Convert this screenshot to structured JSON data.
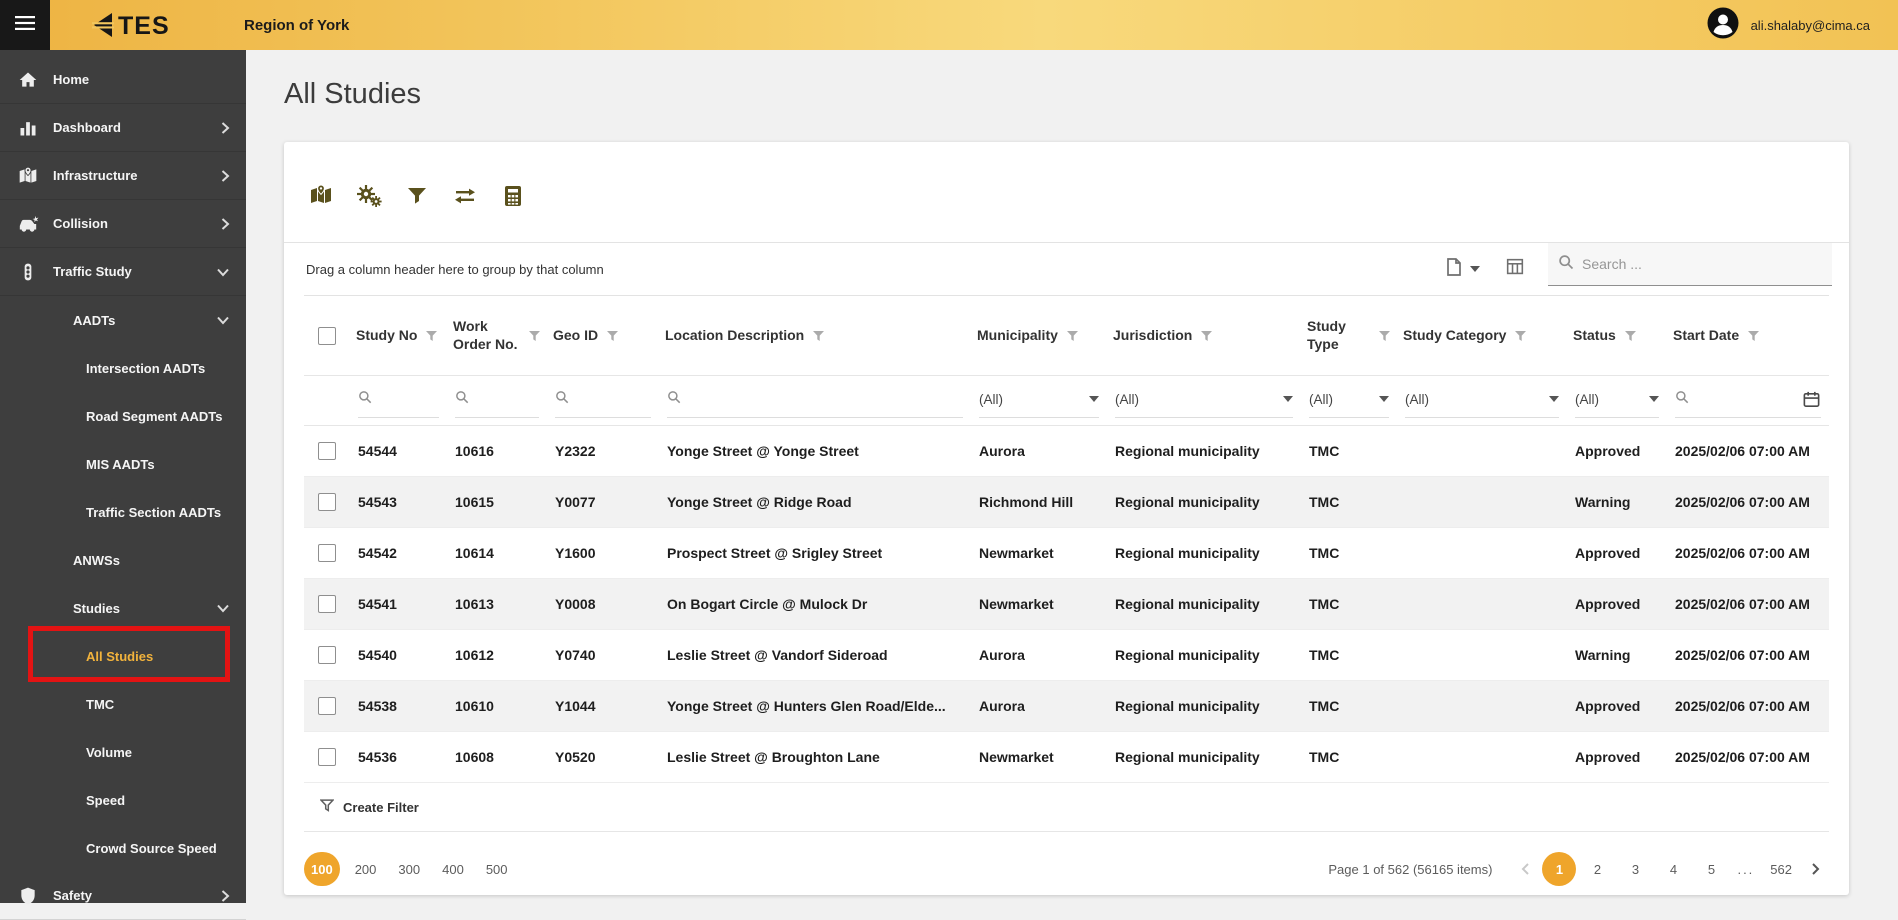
{
  "topbar": {
    "brand": "TES",
    "region": "Region of York",
    "user_email": "ali.shalaby@cima.ca"
  },
  "sidebar": {
    "items": [
      {
        "label": "Home"
      },
      {
        "label": "Dashboard"
      },
      {
        "label": "Infrastructure"
      },
      {
        "label": "Collision"
      },
      {
        "label": "Traffic Study"
      },
      {
        "label": "AADTs"
      },
      {
        "label": "Intersection AADTs"
      },
      {
        "label": "Road Segment AADTs"
      },
      {
        "label": "MIS AADTs"
      },
      {
        "label": "Traffic Section AADTs"
      },
      {
        "label": "ANWSs"
      },
      {
        "label": "Studies"
      },
      {
        "label": "All Studies"
      },
      {
        "label": "TMC"
      },
      {
        "label": "Volume"
      },
      {
        "label": "Speed"
      },
      {
        "label": "Crowd Source Speed"
      },
      {
        "label": "Safety"
      }
    ]
  },
  "page": {
    "title": "All Studies"
  },
  "grid": {
    "group_hint": "Drag a column header here to group by that column",
    "search_placeholder": "Search ...",
    "filter_all": "(All)",
    "columns": [
      "Study No",
      "Work Order No.",
      "Geo ID",
      "Location Description",
      "Municipality",
      "Jurisdiction",
      "Study Type",
      "Study Category",
      "Status",
      "Start Date"
    ],
    "rows": [
      {
        "study_no": "54544",
        "work_order": "10616",
        "geo_id": "Y2322",
        "location": "Yonge Street @ Yonge Street",
        "municipality": "Aurora",
        "jurisdiction": "Regional municipality",
        "study_type": "TMC",
        "category": "",
        "status": "Approved",
        "start_date": "2025/02/06 07:00 AM"
      },
      {
        "study_no": "54543",
        "work_order": "10615",
        "geo_id": "Y0077",
        "location": "Yonge Street @ Ridge Road",
        "municipality": "Richmond Hill",
        "jurisdiction": "Regional municipality",
        "study_type": "TMC",
        "category": "",
        "status": "Warning",
        "start_date": "2025/02/06 07:00 AM"
      },
      {
        "study_no": "54542",
        "work_order": "10614",
        "geo_id": "Y1600",
        "location": "Prospect Street @ Srigley Street",
        "municipality": "Newmarket",
        "jurisdiction": "Regional municipality",
        "study_type": "TMC",
        "category": "",
        "status": "Approved",
        "start_date": "2025/02/06 07:00 AM"
      },
      {
        "study_no": "54541",
        "work_order": "10613",
        "geo_id": "Y0008",
        "location": "On Bogart Circle @ Mulock Dr",
        "municipality": "Newmarket",
        "jurisdiction": "Regional municipality",
        "study_type": "TMC",
        "category": "",
        "status": "Approved",
        "start_date": "2025/02/06 07:00 AM"
      },
      {
        "study_no": "54540",
        "work_order": "10612",
        "geo_id": "Y0740",
        "location": "Leslie Street @ Vandorf Sideroad",
        "municipality": "Aurora",
        "jurisdiction": "Regional municipality",
        "study_type": "TMC",
        "category": "",
        "status": "Warning",
        "start_date": "2025/02/06 07:00 AM"
      },
      {
        "study_no": "54538",
        "work_order": "10610",
        "geo_id": "Y1044",
        "location": "Yonge Street @ Hunters Glen Road/Elde...",
        "municipality": "Aurora",
        "jurisdiction": "Regional municipality",
        "study_type": "TMC",
        "category": "",
        "status": "Approved",
        "start_date": "2025/02/06 07:00 AM"
      },
      {
        "study_no": "54536",
        "work_order": "10608",
        "geo_id": "Y0520",
        "location": "Leslie Street @ Broughton Lane",
        "municipality": "Newmarket",
        "jurisdiction": "Regional municipality",
        "study_type": "TMC",
        "category": "",
        "status": "Approved",
        "start_date": "2025/02/06 07:00 AM"
      }
    ],
    "create_filter_label": "Create Filter",
    "pagination": {
      "page_sizes": [
        "100",
        "200",
        "300",
        "400",
        "500"
      ],
      "active_size": "100",
      "info": "Page 1 of 562 (56165 items)",
      "pages": [
        "1",
        "2",
        "3",
        "4",
        "5",
        "...",
        "562"
      ],
      "active_page": "1"
    }
  },
  "icons": {
    "toolbar": [
      "map-icon",
      "settings-icon",
      "filter-icon",
      "swap-icon",
      "calculator-icon"
    ]
  },
  "colors": {
    "accent": "#EFA52B",
    "topbar": "#F4C65F",
    "sidebar_bg": "#3E3E3E",
    "active_item": "#F2B33C",
    "highlight_red": "#E31313"
  }
}
